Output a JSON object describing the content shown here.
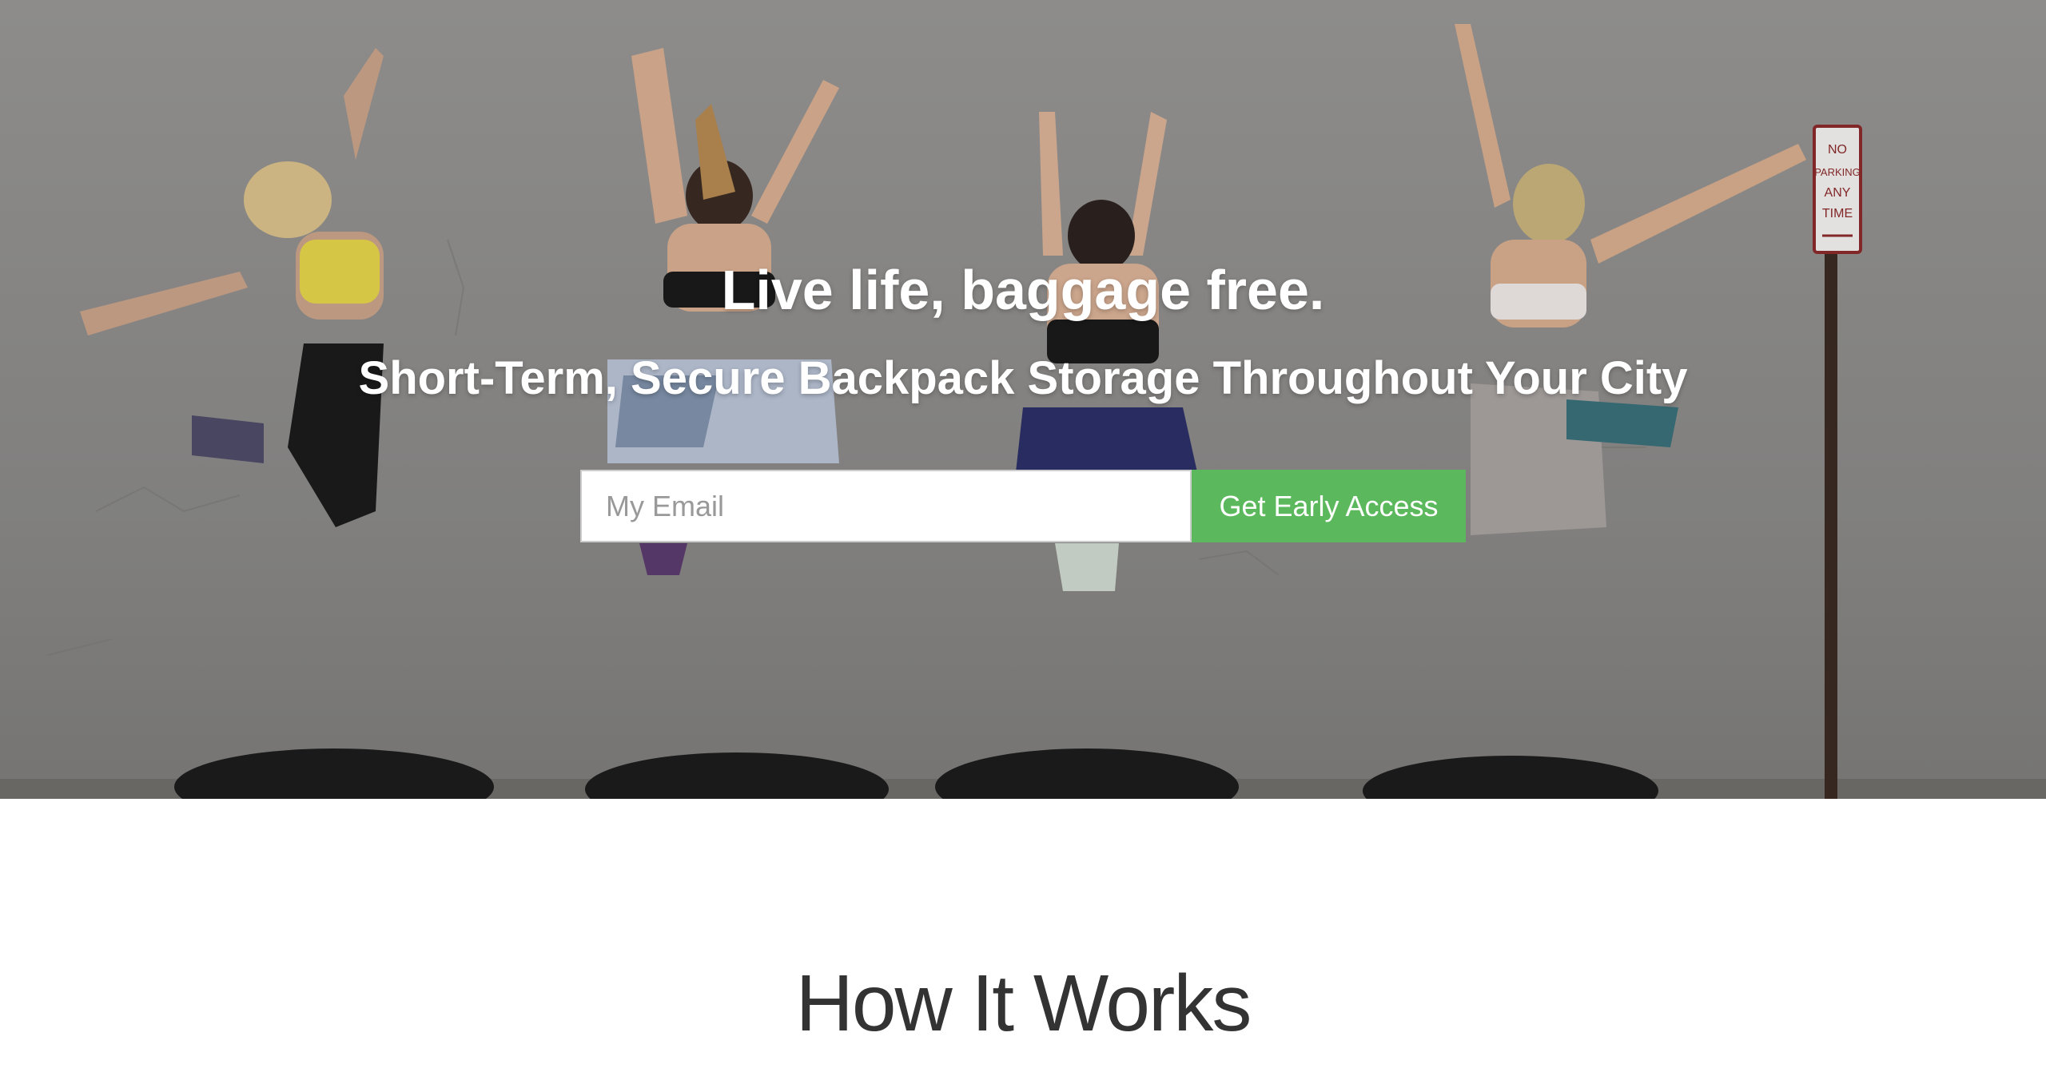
{
  "hero": {
    "headline": "Live life, baggage free.",
    "subheadline": "Short-Term, Secure Backpack Storage Throughout Your City",
    "sign_text": [
      "NO",
      "PARKING",
      "ANY",
      "TIME"
    ]
  },
  "signup": {
    "email_placeholder": "My Email",
    "email_value": "",
    "button_label": "Get Early Access"
  },
  "how_it_works": {
    "title": "How It Works"
  },
  "colors": {
    "cta_button": "#5cb85c",
    "hero_text": "#ffffff",
    "section_title": "#333333"
  }
}
